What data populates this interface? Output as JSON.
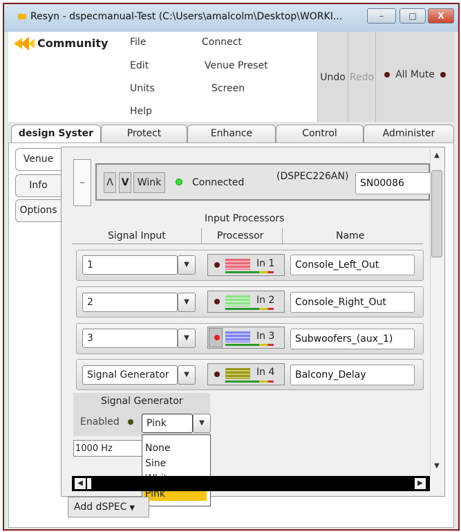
{
  "window": {
    "title": "Resyn - dspecmanual-Test (C:\\Users\\amalcolm\\Desktop\\WORKI...",
    "controls": {
      "minimize": "–",
      "maximize": "□",
      "close": "X"
    }
  },
  "brand": {
    "name": "Community"
  },
  "menu": {
    "col1": [
      "File",
      "Edit",
      "Units",
      "Help"
    ],
    "col2": [
      "Connect",
      "Venue Preset",
      "Screen"
    ]
  },
  "toolbar": {
    "undo": "Undo",
    "redo": "Redo",
    "all_mute": "All Mute"
  },
  "tabs": [
    "design Syster",
    "Protect",
    "Enhance",
    "Control",
    "Administer"
  ],
  "side_tabs": [
    "Venue",
    "Info",
    "Options"
  ],
  "device": {
    "collapse": "–",
    "up": "Λ",
    "down": "V",
    "wink": "Wink",
    "status": "Connected",
    "model": "(DSPEC226AN)",
    "serial": "SN00086"
  },
  "headers": {
    "input_processors": "Input Processors",
    "signal_input": "Signal Input",
    "processor": "Processor",
    "name": "Name"
  },
  "rows": [
    {
      "input": "1",
      "channel": "In 1",
      "name": "Console_Left_Out",
      "color": "#e86a78"
    },
    {
      "input": "2",
      "channel": "In 2",
      "name": "Console_Right_Out",
      "color": "#8fe08a"
    },
    {
      "input": "3",
      "channel": "In 3",
      "name": "Subwoofers_(aux_1)",
      "color": "#7f83ee"
    },
    {
      "input": "Signal Generator",
      "channel": "In 4",
      "name": "Balcony_Delay",
      "color": "#9a9a1a"
    }
  ],
  "signal_generator": {
    "title": "Signal Generator",
    "enabled_label": "Enabled",
    "selected": "Pink",
    "frequency": "1000 Hz",
    "options": [
      "None",
      "Sine",
      "White",
      "Pink"
    ]
  },
  "add_button": "Add dSPEC"
}
